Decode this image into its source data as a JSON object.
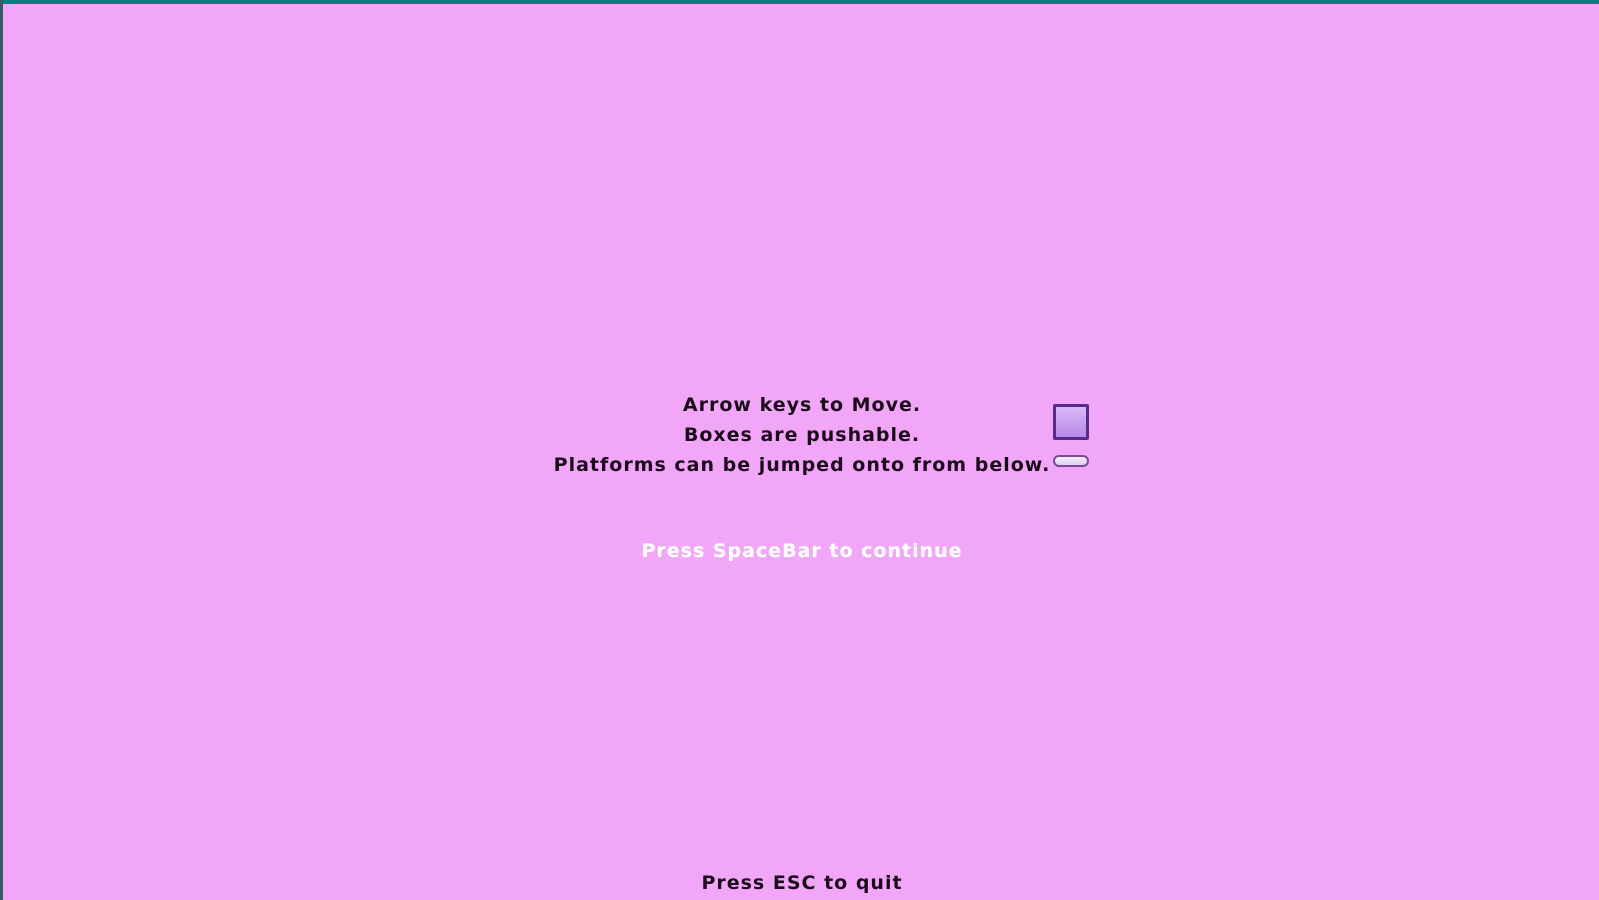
{
  "screen": {
    "background_color": "#f2a6f8",
    "frame_accent_color": "#0b7c86"
  },
  "instructions": [
    "Arrow keys to Move.",
    "Boxes are pushable.",
    "Platforms can be jumped onto from below."
  ],
  "sprites": {
    "box_icon": "pushable-box-icon",
    "platform_icon": "platform-icon",
    "box_color": "#c7a3f0",
    "box_border_color": "#5a2a8a"
  },
  "prompts": {
    "continue": "Press SpaceBar to continue",
    "quit": "Press ESC to quit"
  }
}
